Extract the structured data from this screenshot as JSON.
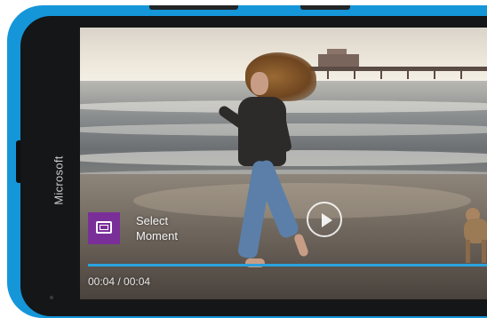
{
  "device": {
    "brand": "Microsoft",
    "body_color": "#1596d9"
  },
  "video": {
    "play_icon": "play-icon",
    "select_moment": {
      "icon": "film-frame-icon",
      "label": "Select Moment",
      "icon_color": "#7a2f98"
    },
    "progress": {
      "fraction": 1.0,
      "color": "#2aa3e0"
    },
    "time": "00:04 / 00:04"
  }
}
